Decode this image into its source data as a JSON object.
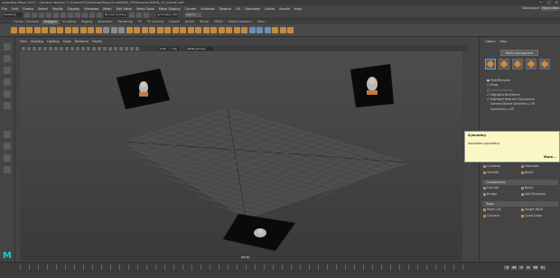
{
  "window": {
    "title": "Autodesk Maya 2017 - Student Version: C:\\Users\\PC\\Desktop\\Maya Kurs\\MAYA_YENI\\scenes\\MAYA_10_scene.mb*",
    "min": "—",
    "max": "▢",
    "close": "✕"
  },
  "menubar": {
    "items": [
      "File",
      "Edit",
      "Create",
      "Select",
      "Modify",
      "Display",
      "Windows",
      "Mesh",
      "Edit Mesh",
      "Mesh Tools",
      "Mesh Display",
      "Curves",
      "Surfaces",
      "Deform",
      "UV",
      "Generate",
      "Cache",
      "Arnold",
      "Help"
    ],
    "workspace_label": "Workspace:",
    "workspace_value": "Maya Classic"
  },
  "status": {
    "mode": "Modeling",
    "no_live": "No Live Surface",
    "symmetry": "Symmetry: Off",
    "signin": "Sign In"
  },
  "shelf": {
    "tabs": [
      "Curves / Surfaces",
      "Polygons",
      "Sculpting",
      "Rigging",
      "Animation",
      "Rendering",
      "FX",
      "FX Caching",
      "Custom",
      "Arnold",
      "Bifrost",
      "MASH",
      "Motion Graphics",
      "XGen"
    ],
    "active": "Polygons"
  },
  "viewport": {
    "menu": [
      "View",
      "Shading",
      "Lighting",
      "Show",
      "Renderer",
      "Panels"
    ],
    "field_a": "0.00",
    "field_b": "1.00",
    "colorspace": "sRGB gamma",
    "camera_label": "persp"
  },
  "modeling_toolkit": {
    "menu": [
      "Object",
      "Help"
    ],
    "mode_button": "Multi-Component",
    "options": [
      {
        "label": "Pick/Marquee",
        "checked": true,
        "dim": false
      },
      {
        "label": "Drag",
        "checked": false,
        "dim": false
      },
      {
        "label": "Camera Based",
        "checked": false,
        "dim": true
      },
      {
        "label": "Highlight Backfaces",
        "checked": true,
        "dim": false
      },
      {
        "label": "Highlight Nearest Component",
        "checked": true,
        "dim": false
      },
      {
        "label": "Camera Based Selection ▸ Off",
        "checked": false,
        "dim": false
      },
      {
        "label": "Symmetry ▸ Off",
        "checked": false,
        "dim": false
      }
    ],
    "sections": {
      "components": "Components",
      "tools": "Tools"
    },
    "row1": [
      "Combine",
      "Separate"
    ],
    "row2": [
      "Smooth",
      "Bevel"
    ],
    "row3": [
      "Extrude",
      "Bevel"
    ],
    "row4": [
      "Bridge",
      "Add Divisions"
    ],
    "row5": [
      "Multi-Cut",
      "Target Weld"
    ],
    "row6": [
      "Connect",
      "Quad Draw"
    ]
  },
  "tooltip": {
    "title": "Symmetry",
    "body": "Activates symmetry",
    "more": "More..."
  },
  "timeline": {
    "controls": [
      "|◀",
      "◀◀",
      "◀",
      "▶",
      "▶▶",
      "▶|"
    ]
  },
  "colors": {
    "accent": "#2ec4c4",
    "tooltip_bg": "#fbf7c4",
    "icon_orange": "#c58a3e"
  }
}
